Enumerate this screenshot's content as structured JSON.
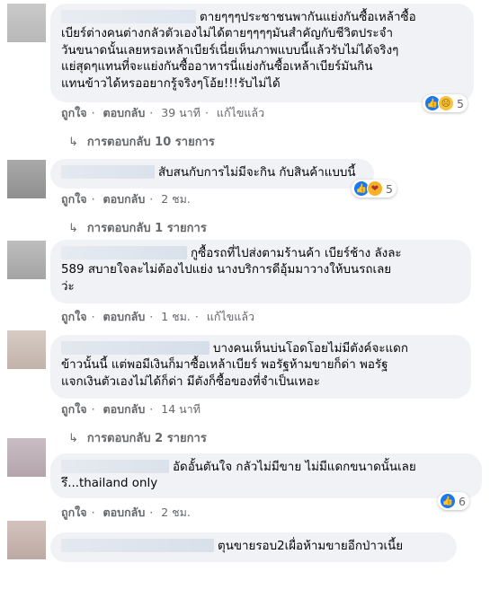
{
  "comments": [
    {
      "text_lines": [
        "ตายๆๆๆประชาชนพากันแย่งกันซื้อเหล้าซื้อ",
        "เบียร์ต่างคนต่างกลัวตัวเองไม่ได้ตายๆๆๆๆมันสำคัญกับชีวิตประจำ",
        "วันขนาดนั้นเลยหรอเหล้าเบียร์เนี่ยเห็นภาพแบบนี้แล้วรับไม่ได้จริงๆ",
        "แย่สุดๆแทนที่จะแย่งกันซื้ออาหารนี่แย่งกันซื้อเหล้าเบียร์มันกิน",
        "แทนข้าวได้หรออยากรู้จริงๆโอ้ย!!!รับไม่ได้"
      ],
      "actions": {
        "like": "ถูกใจ",
        "reply": "ตอบกลับ",
        "time": "39 นาที",
        "edited": "แก้ไขแล้ว"
      },
      "reactions": {
        "icons": [
          "like-icon",
          "sad-icon"
        ],
        "count": "5"
      },
      "replies": "การตอบกลับ 10 รายการ"
    },
    {
      "text_lines": [
        "สับสนกับการไม่มีจะกิน กับสินค้าแบบนี้"
      ],
      "actions": {
        "like": "ถูกใจ",
        "reply": "ตอบกลับ",
        "time": "2 ชม."
      },
      "reactions": {
        "icons": [
          "like-icon",
          "care-icon"
        ],
        "count": "5"
      },
      "replies": "การตอบกลับ 1 รายการ"
    },
    {
      "text_lines": [
        "กูซื้อรถที่ไปส่งตามร้านค้า เบียร์ช้าง ลังละ",
        "589 สบายใจละไม่ต้องไปแย่ง นางบริการดีอุ้มมาวางให้บนรถเลย",
        "ว่ะ"
      ],
      "actions": {
        "like": "ถูกใจ",
        "reply": "ตอบกลับ",
        "time": "1 ชม.",
        "edited": "แก้ไขแล้ว"
      }
    },
    {
      "text_lines": [
        "บางคนเห็นบ่นโอดโอยไม่มีตังค์จะแดก",
        "ข้าวนั้นนี้ แต่พอมีเงินก็มาซื้อเหล้าเบียร์ พอรัฐห้ามขายก็ด่า พอรัฐ",
        "แจกเงินตัวเองไม่ได้ก็ด่า มีตังก็ซื้อของที่จำเป็นเหอะ"
      ],
      "actions": {
        "like": "ถูกใจ",
        "reply": "ตอบกลับ",
        "time": "14 นาที"
      },
      "replies": "การตอบกลับ 2 รายการ"
    },
    {
      "text_lines": [
        "อัดอั้นตันใจ กลัวไม่มีขาย ไม่มีแดกขนาดนั้นเลย",
        "รึ...thailand only"
      ],
      "actions": {
        "like": "ถูกใจ",
        "reply": "ตอบกลับ",
        "time": "2 ชม."
      },
      "reactions": {
        "icons": [
          "like-icon"
        ],
        "count": "6"
      }
    },
    {
      "text_lines": [
        "ตุนขายรอบ2เผื่อห้ามขายอีกป่าวเนี้ย"
      ]
    }
  ],
  "colors": {
    "bubble": "#f0f2f5",
    "link": "#65676b",
    "like": "#1877f2"
  }
}
